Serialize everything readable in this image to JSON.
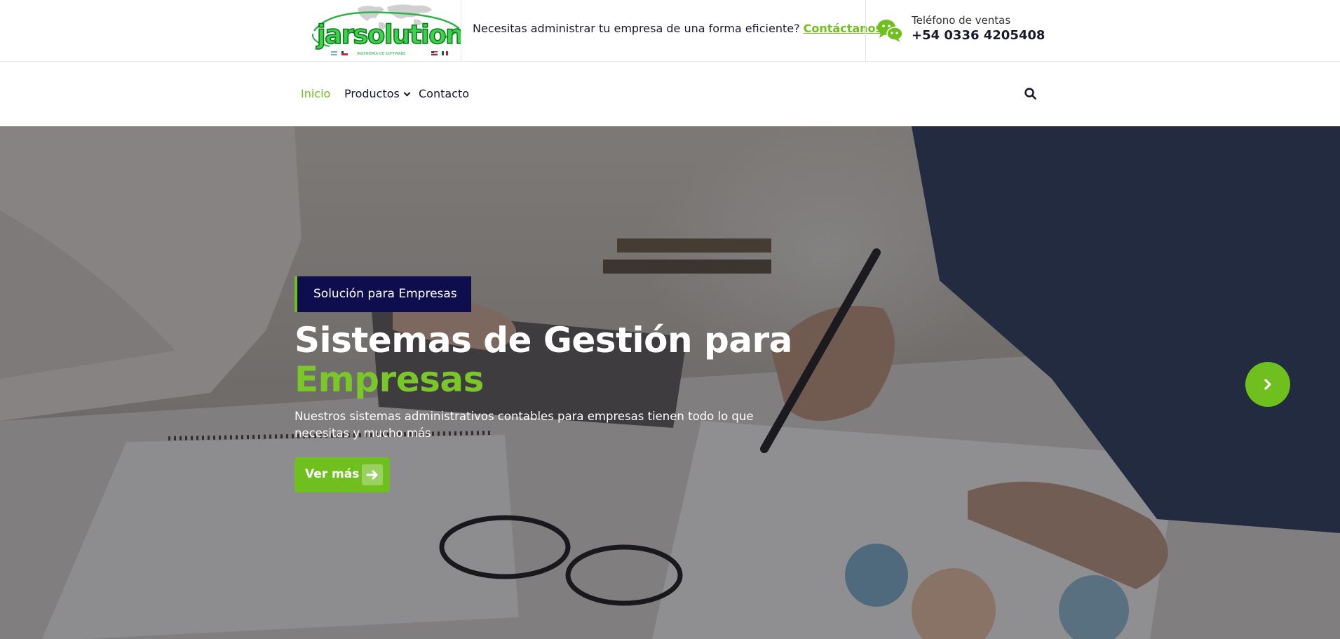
{
  "brand": {
    "logo_text": "jarsolutions",
    "logo_tagline": "INGENIERÍA DE SOFTWARE",
    "accent_color": "#6fbf1f",
    "navy_color": "#0e0e4e"
  },
  "topbar": {
    "promo_text": "Necesitas administrar tu empresa de una forma eficiente?",
    "promo_link": "Contáctanos",
    "phone_label": "Teléfono de ventas",
    "phone_number": "+54 0336 4205408",
    "chat_icon": "wechat-icon"
  },
  "nav": {
    "items": [
      {
        "label": "Inicio",
        "active": true
      },
      {
        "label": "Productos",
        "has_dropdown": true
      },
      {
        "label": "Contacto"
      }
    ],
    "search_icon": "search-icon"
  },
  "hero": {
    "badge": "Solución para Empresas",
    "title_line1": "Sistemas de Gestión para",
    "title_line2": "Empresas",
    "subtitle": "Nuestros sistemas administrativos contables para empresas tienen todo lo que necesitas y mucho más",
    "cta_label": "Ver más",
    "cta_icon": "arrow-right-icon",
    "next_icon": "chevron-right-icon"
  }
}
